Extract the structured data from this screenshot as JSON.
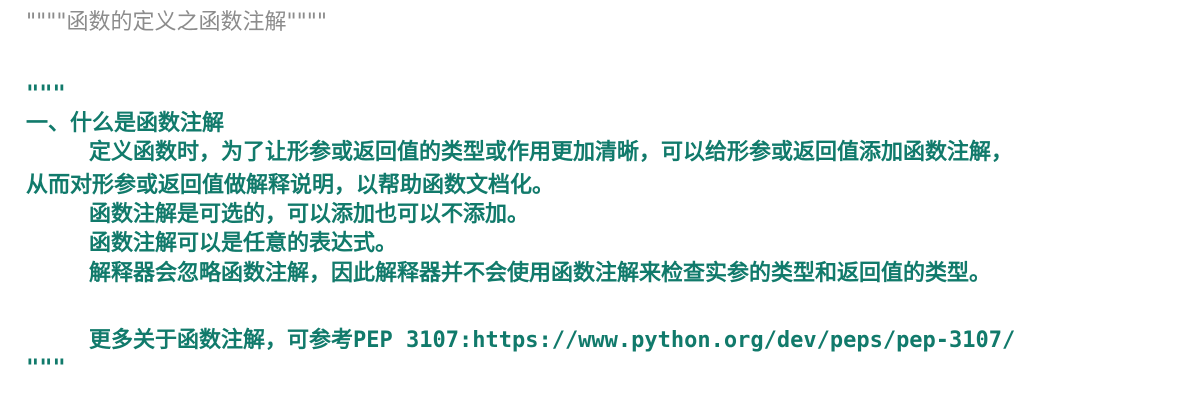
{
  "code_lines": {
    "comment_title": "\"\"\"\"函数的定义之函数注解\"\"\"\"",
    "doc_open": "\"\"\"",
    "heading": "一、什么是函数注解",
    "para1_line1": "定义函数时，为了让形参或返回值的类型或作用更加清晰，可以给形参或返回值添加函数注解，",
    "para1_line2": "从而对形参或返回值做解释说明，以帮助函数文档化。",
    "para2": "函数注解是可选的，可以添加也可以不添加。",
    "para3": "函数注解可以是任意的表达式。",
    "para4": "解释器会忽略函数注解，因此解释器并不会使用函数注解来检查实参的类型和返回值的类型。",
    "more_prefix": "更多关于函数注解，可参考",
    "more_url": "PEP 3107:https://www.python.org/dev/peps/pep-3107/",
    "doc_close": "\"\"\""
  },
  "colors": {
    "comment": "#8c8c8c",
    "docstring": "#117a6b",
    "background": "#ffffff"
  }
}
